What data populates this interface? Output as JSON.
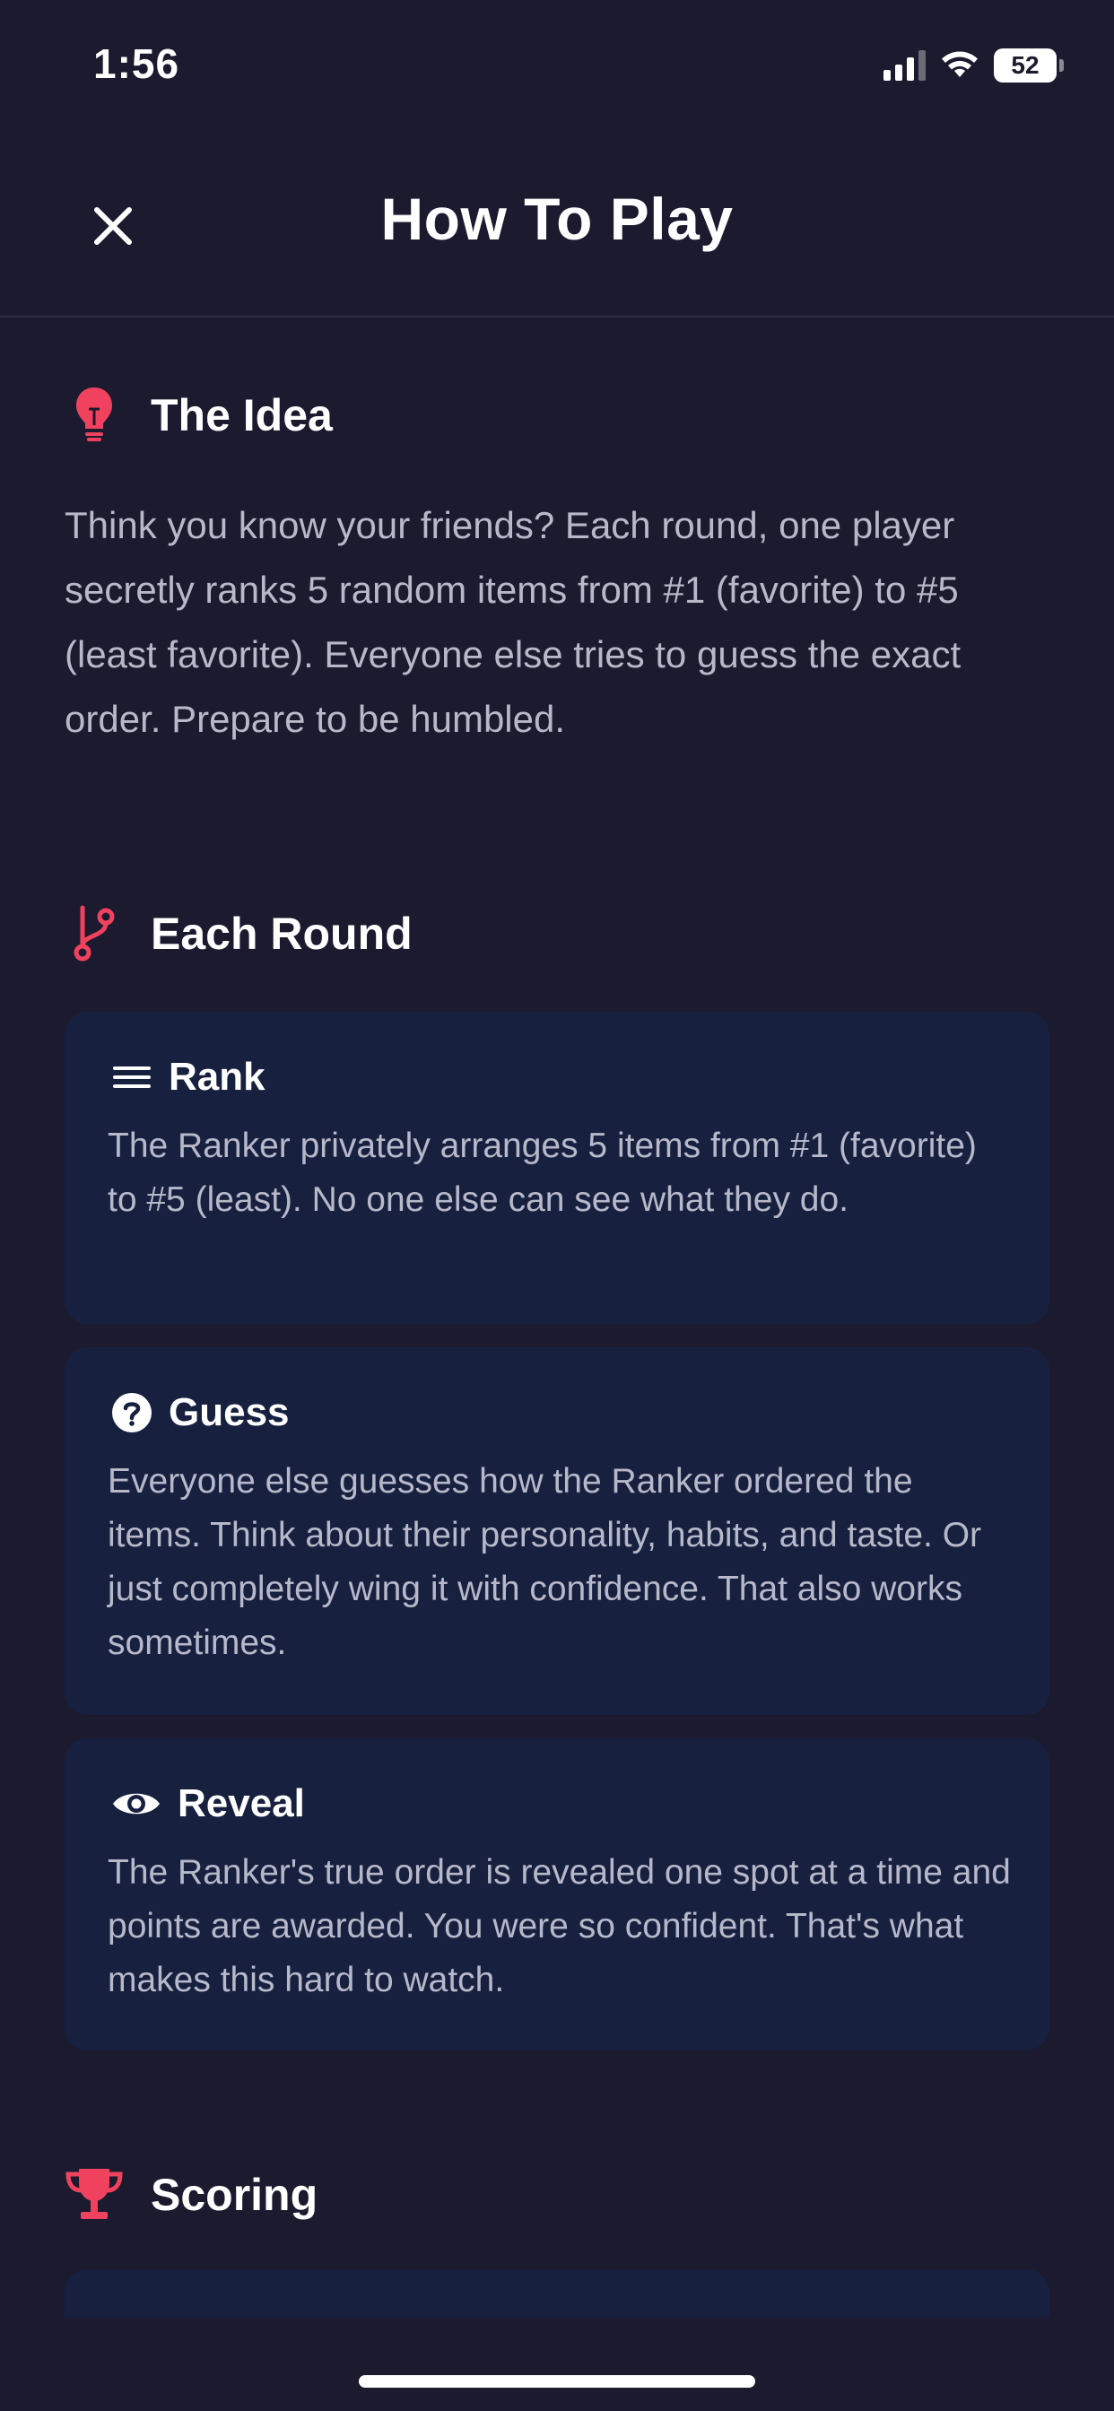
{
  "status_bar": {
    "time": "1:56",
    "battery": "52"
  },
  "header": {
    "title": "How To Play"
  },
  "sections": {
    "idea": {
      "title": "The Idea",
      "body": "Think you know your friends? Each round, one player secretly ranks 5 random items from #1 (favorite) to #5 (least favorite). Everyone else tries to guess the exact order. Prepare to be humbled."
    },
    "each_round": {
      "title": "Each Round",
      "cards": [
        {
          "icon": "menu-lines-icon",
          "title": "Rank",
          "body": "The Ranker privately arranges 5 items from #1 (favorite) to #5 (least). No one else can see what they do."
        },
        {
          "icon": "question-circle-icon",
          "title": "Guess",
          "body": "Everyone else guesses how the Ranker ordered the items. Think about their personality, habits, and taste. Or just completely wing it with confidence. That also works sometimes."
        },
        {
          "icon": "eye-icon",
          "title": "Reveal",
          "body": "The Ranker's true order is revealed one spot at a time and points are awarded. You were so confident. That's what makes this hard to watch."
        }
      ]
    },
    "scoring": {
      "title": "Scoring"
    }
  },
  "colors": {
    "background": "#1b1a2e",
    "card": "#17213f",
    "accent": "#f0425f",
    "body_text": "#b9b8c8"
  },
  "icons": {
    "idea": "lightbulb-icon",
    "each_round": "branch-icon",
    "scoring": "trophy-icon",
    "close": "close-icon"
  }
}
